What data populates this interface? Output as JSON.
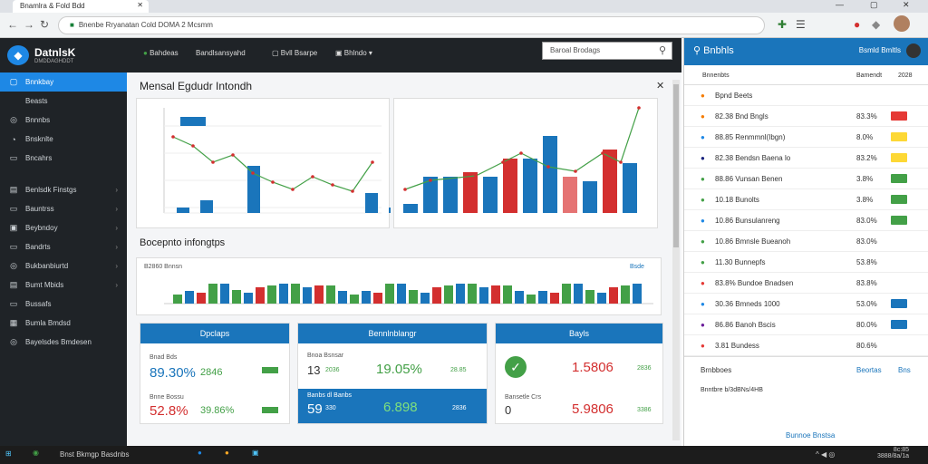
{
  "browser": {
    "tab_title": "Bnamlra & Fold Bdd",
    "url": "Bnenbe Rryanatan Cold DOMA 2 Mcsmm"
  },
  "app": {
    "brand": "DatnlsK",
    "brand_sub": "DMDDAGHDDT"
  },
  "sidebar": {
    "items": [
      {
        "label": "Bnnkbay",
        "icon": "▢",
        "active": true
      },
      {
        "label": "Beasts",
        "icon": "",
        "active": false
      },
      {
        "label": "Bnnnbs",
        "icon": "◎",
        "active": false
      },
      {
        "label": "Bnsknlte",
        "icon": "◔",
        "active": false
      },
      {
        "label": "Bncahrs",
        "icon": "▭",
        "active": false
      },
      {
        "label": "Benlsdk Finstgs",
        "icon": "▤",
        "active": false
      },
      {
        "label": "Bauntrss",
        "icon": "▭",
        "active": false
      },
      {
        "label": "Beybndoy",
        "icon": "▣",
        "active": false
      },
      {
        "label": "Bandrts",
        "icon": "▭",
        "active": false
      },
      {
        "label": "Bukbanbiurtd",
        "icon": "◎",
        "active": false
      },
      {
        "label": "Bumt Mbids",
        "icon": "▤",
        "active": false
      },
      {
        "label": "Bussafs",
        "icon": "▭",
        "active": false
      },
      {
        "label": "Bumla Bmdsd",
        "icon": "▦",
        "active": false
      },
      {
        "label": "Bayelsdes Bmdesen",
        "icon": "◎",
        "active": false
      }
    ]
  },
  "topnav": {
    "items": [
      "Bahdeas",
      "Bandlsansyahd",
      "Bvll Bsarpe",
      "Bhlndo"
    ]
  },
  "search": {
    "placeholder": "Baroal Brodags"
  },
  "main": {
    "title": "Mensal Egdudr Intondh",
    "section2": "Bocepnto infongtps",
    "bars_left_label": "B2860 Bnnsn",
    "bars_right_label": "Bsde",
    "cards": [
      {
        "head": "Dpclaps",
        "r1a": "89.30%",
        "r1b": "2846",
        "r2a": "52.8%",
        "r2b": "39.86%",
        "l1": "Bnad Bds",
        "l2": "Bnne Bossu"
      },
      {
        "head": "Bennlnblangr",
        "r1a": "13",
        "r1b": "2036",
        "r1c": "19.05%",
        "r1d": "28.85",
        "r2a": "59",
        "r2b": "330",
        "r2c": "6.898",
        "r2d": "2836",
        "l1": "Bnoa Bsnsar",
        "l2": "Banbs dl Banbs"
      },
      {
        "head": "Bayls",
        "v1": "1.5806",
        "v2": "2836",
        "v3": "0",
        "v4": "5.9806",
        "v5": "3386",
        "l2": "Bansetle Crs"
      }
    ]
  },
  "right": {
    "title": "Bnbhls",
    "user": "Bsmld Bmltls",
    "col1": "Bnnenbts",
    "col2": "Bamendt",
    "col3": "2028",
    "rows": [
      {
        "a": "Bpnd Beets",
        "b": "",
        "c": ""
      },
      {
        "a": "82.38 Bnd Bngls",
        "b": "83.3%",
        "c": "#e53935"
      },
      {
        "a": "88.85 Renmmnl(Ibgn)",
        "b": "8.0%",
        "c": "#fdd835"
      },
      {
        "a": "82.38 Bendsn Baena lo",
        "b": "83.2%",
        "c": "#fdd835"
      },
      {
        "a": "88.86 Vunsan Benen",
        "b": "3.8%",
        "c": "#43a047"
      },
      {
        "a": "10.18 Bunolts",
        "b": "3.8%",
        "c": "#43a047"
      },
      {
        "a": "10.86 Bunsulanreng",
        "b": "83.0%",
        "c": "#43a047"
      },
      {
        "a": "10.86 Bmnsle Bueanoh",
        "b": "83.0%",
        "c": ""
      },
      {
        "a": "11.30 Bunnepfs",
        "b": "53.8%",
        "c": ""
      },
      {
        "a": "83.8% Bundoe Bnadsen",
        "b": "83.8%",
        "c": ""
      },
      {
        "a": "30.36 Bmneds 1000",
        "b": "53.0%",
        "c": "#1a75bb"
      },
      {
        "a": "86.86 Banoh Bscis",
        "b": "80.0%",
        "c": "#1a75bb"
      },
      {
        "a": "3.81 Bundess",
        "b": "80.6%",
        "c": ""
      }
    ],
    "foot1": "Brnbboes",
    "foot2": "Beortas",
    "foot3": "Bns",
    "foot4": "Bnntbre b/3dBNs/4HB",
    "foot5": "Bunnoe Bnstsa"
  },
  "taskbar": {
    "app": "Bnst Bkmgp Basdnbs",
    "clock": "8c:85",
    "date": "3888/8a/1a"
  },
  "chart_data": [
    {
      "type": "line",
      "title": "",
      "series": [
        {
          "name": "",
          "values": [
            88,
            78,
            60,
            68,
            48,
            38,
            30,
            44,
            35,
            28,
            60
          ]
        }
      ]
    },
    {
      "type": "bar",
      "title": "",
      "series": [
        {
          "name": "",
          "values": [
            10,
            40,
            40,
            45,
            40,
            60,
            60,
            85,
            40,
            35,
            70,
            55
          ]
        }
      ]
    },
    {
      "type": "bar",
      "title": "",
      "values": [
        10,
        14,
        12,
        22,
        22,
        15,
        12,
        18,
        20,
        22,
        22,
        18,
        20,
        20,
        14
      ]
    }
  ]
}
